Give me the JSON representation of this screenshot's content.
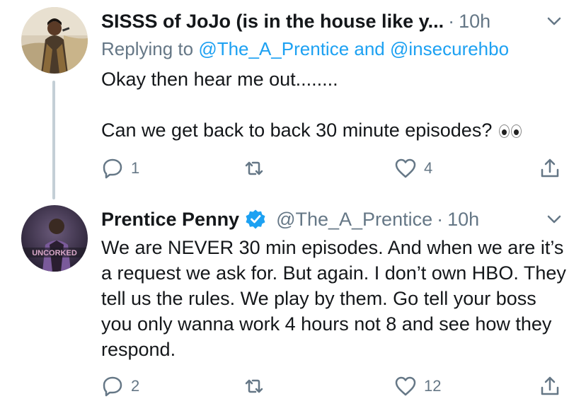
{
  "tweets": [
    {
      "display_name": "SISSS of JoJo (is in the house like y...",
      "time": "10h",
      "reply_prefix": "Replying to",
      "reply_to_1": "@The_A_Prentice",
      "reply_and": "and",
      "reply_to_2": "@insecurehbo",
      "body_line_1": "Okay then hear me out........",
      "body_line_2": "Can we get back to back 30 minute episodes?",
      "emoji": "eyes-emoji",
      "reply_count": "1",
      "retweet_count": "",
      "like_count": "4"
    },
    {
      "display_name": "Prentice Penny",
      "handle": "@The_A_Prentice",
      "time": "10h",
      "verified": true,
      "avatar_text": "UNCORKED",
      "body": "We are NEVER 30 min episodes. And when we are it’s a request we ask for. But again. I don’t own HBO. They tell us the rules. We play by them. Go tell your boss you only wanna work 4 hours not 8 and see how they respond.",
      "reply_count": "2",
      "retweet_count": "",
      "like_count": "12"
    }
  ],
  "icons": {
    "reply": "reply-icon",
    "retweet": "retweet-icon",
    "like": "heart-icon",
    "share": "share-icon",
    "caret": "chevron-down-icon",
    "verified": "verified-badge-icon"
  },
  "colors": {
    "text": "#14171a",
    "secondary": "#657786",
    "link": "#1da1f2",
    "thread_line": "#c4cfd6"
  }
}
